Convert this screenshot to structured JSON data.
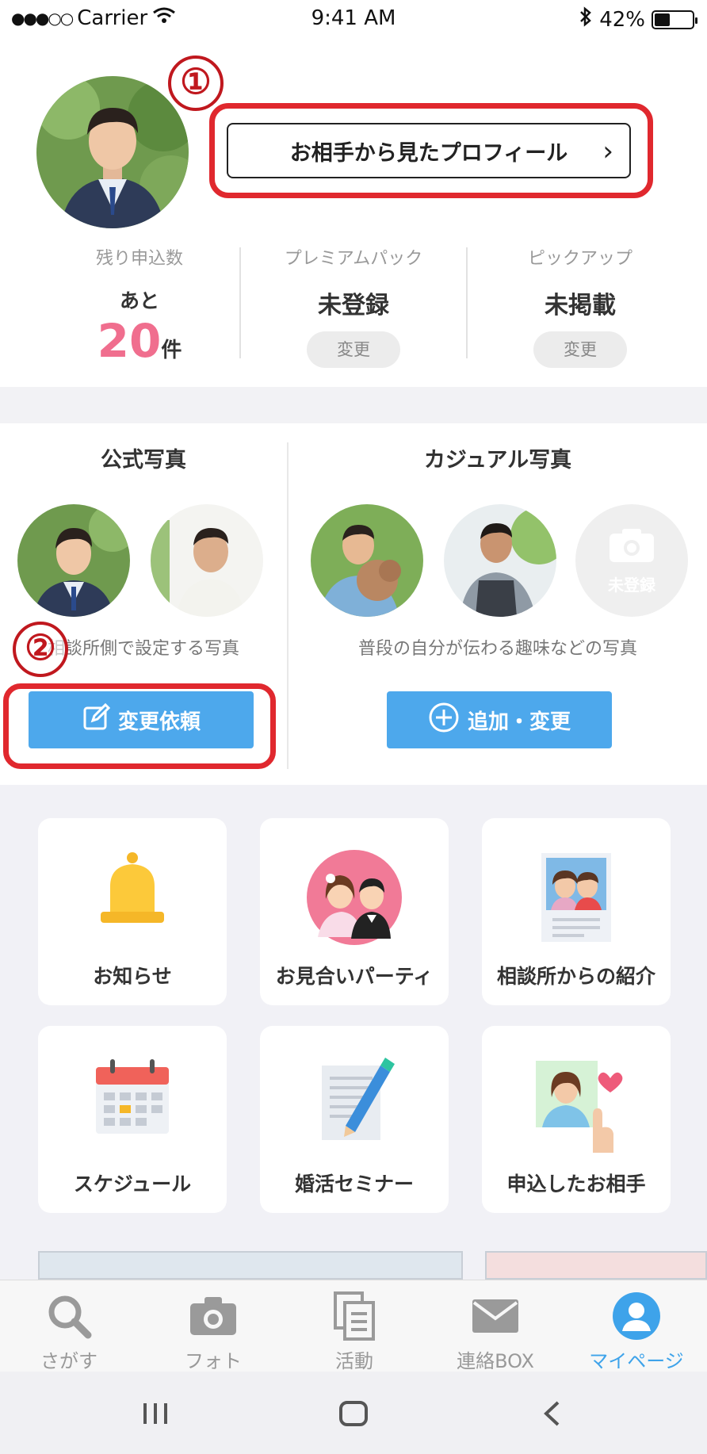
{
  "status_bar": {
    "signal": "●●●○○",
    "carrier": "Carrier",
    "time": "9:41 AM",
    "battery_percent": "42%",
    "battery_level": 0.42
  },
  "profile": {
    "view_as_partner_label": "お相手から見たプロフィール",
    "marker_1": "①"
  },
  "stats": [
    {
      "label": "残り申込数",
      "prefix": "あと",
      "count": "20",
      "unit": "件"
    },
    {
      "label": "プレミアムパック",
      "value": "未登録",
      "button": "変更"
    },
    {
      "label": "ピックアップ",
      "value": "未掲載",
      "button": "変更"
    }
  ],
  "photos": {
    "official": {
      "title": "公式写真",
      "caption": "相談所側で設定する写真",
      "button": "変更依頼",
      "marker_2": "②"
    },
    "casual": {
      "title": "カジュアル写真",
      "caption": "普段の自分が伝わる趣味などの写真",
      "button": "追加・変更",
      "unregistered": "未登録"
    }
  },
  "menu": [
    {
      "label": "お知らせ",
      "icon": "bell-icon"
    },
    {
      "label": "お見合いパーティ",
      "icon": "couple-icon"
    },
    {
      "label": "相談所からの紹介",
      "icon": "introduction-icon"
    },
    {
      "label": "スケジュール",
      "icon": "calendar-icon"
    },
    {
      "label": "婚活セミナー",
      "icon": "seminar-icon"
    },
    {
      "label": "申込したお相手",
      "icon": "applied-partner-icon"
    }
  ],
  "tabs": [
    {
      "label": "さがす",
      "icon": "search-icon",
      "active": false
    },
    {
      "label": "フォト",
      "icon": "camera-icon",
      "active": false
    },
    {
      "label": "活動",
      "icon": "documents-icon",
      "active": false
    },
    {
      "label": "連絡BOX",
      "icon": "mail-icon",
      "active": false
    },
    {
      "label": "マイページ",
      "icon": "user-icon",
      "active": true
    }
  ],
  "colors": {
    "accent_blue": "#4da8ec",
    "active_tab": "#3ea3ea",
    "highlight_red": "#e0282e",
    "count_pink": "#f06e8e"
  }
}
